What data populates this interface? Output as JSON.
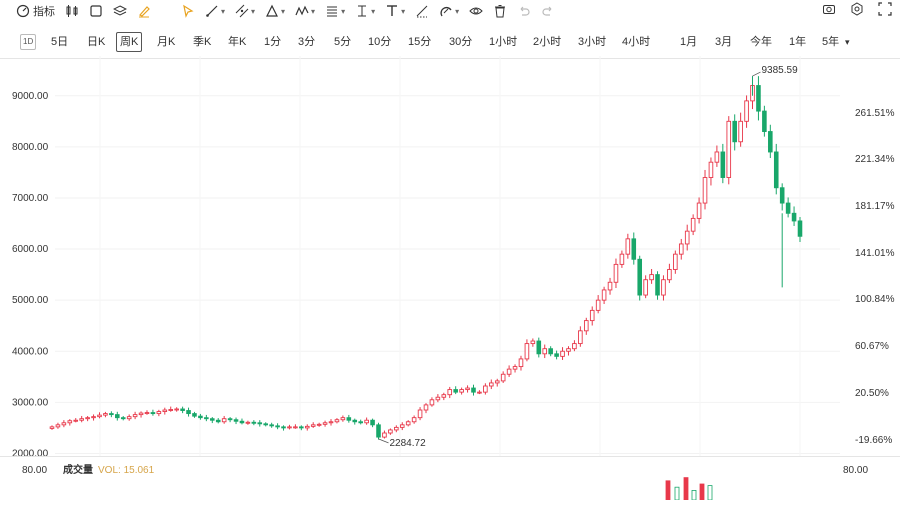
{
  "toolbar": {
    "indicator_label": "指标"
  },
  "periods": [
    {
      "label": "1D",
      "box": true
    },
    {
      "label": "5日"
    },
    {
      "label": "日K"
    },
    {
      "label": "周K",
      "active": true
    },
    {
      "label": "月K"
    },
    {
      "label": "季K"
    },
    {
      "label": "年K"
    },
    {
      "label": "1分"
    },
    {
      "label": "3分"
    },
    {
      "label": "5分"
    },
    {
      "label": "10分"
    },
    {
      "label": "15分"
    },
    {
      "label": "30分"
    },
    {
      "label": "1小时"
    },
    {
      "label": "2小时"
    },
    {
      "label": "3小时"
    },
    {
      "label": "4小时"
    },
    {
      "label": "1月"
    },
    {
      "label": "3月"
    },
    {
      "label": "今年"
    },
    {
      "label": "1年"
    },
    {
      "label": "5年"
    }
  ],
  "chart_data": {
    "type": "candlestick",
    "y_left_ticks": [
      "9000.00",
      "8000.00",
      "7000.00",
      "6000.00",
      "5000.00",
      "4000.00",
      "3000.00",
      "2000.00"
    ],
    "y_right_ticks": [
      "261.51%",
      "221.34%",
      "181.17%",
      "141.01%",
      "100.84%",
      "60.67%",
      "20.50%",
      "-19.66%"
    ],
    "ylim": [
      1950,
      9700
    ],
    "annotations": {
      "high": {
        "label": "9385.59",
        "value": 9385.59
      },
      "low": {
        "label": "2284.72",
        "value": 2284.72
      }
    },
    "colors": {
      "up": "#e8384a",
      "down": "#19a76a"
    },
    "close": [
      2520,
      2560,
      2600,
      2640,
      2650,
      2680,
      2700,
      2720,
      2750,
      2780,
      2760,
      2700,
      2680,
      2720,
      2760,
      2790,
      2800,
      2780,
      2820,
      2850,
      2860,
      2870,
      2840,
      2780,
      2730,
      2700,
      2680,
      2650,
      2620,
      2680,
      2660,
      2630,
      2600,
      2610,
      2600,
      2580,
      2560,
      2540,
      2520,
      2500,
      2520,
      2520,
      2500,
      2530,
      2560,
      2570,
      2600,
      2620,
      2660,
      2700,
      2650,
      2620,
      2600,
      2650,
      2560,
      2320,
      2400,
      2460,
      2510,
      2560,
      2620,
      2700,
      2850,
      2950,
      3050,
      3100,
      3150,
      3250,
      3200,
      3250,
      3280,
      3200,
      3200,
      3320,
      3380,
      3420,
      3550,
      3650,
      3700,
      3850,
      4150,
      4200,
      3950,
      4050,
      3950,
      3900,
      4000,
      4050,
      4150,
      4400,
      4600,
      4800,
      5000,
      5200,
      5350,
      5700,
      5900,
      6200,
      5800,
      5100,
      5400,
      5500,
      5100,
      5400,
      5600,
      5900,
      6100,
      6350,
      6600,
      6900,
      7400,
      7700,
      7900,
      7400,
      8500,
      8100,
      8500,
      8900,
      9200,
      8700,
      8300,
      7900,
      7200,
      6900,
      6700,
      6550,
      6250
    ]
  },
  "volume": {
    "label": "成交量",
    "vol_text": "VOL: 15.061",
    "left_value": "80.00",
    "right_value": "80.00",
    "bars": [
      12,
      8,
      14,
      6,
      10,
      9
    ]
  }
}
